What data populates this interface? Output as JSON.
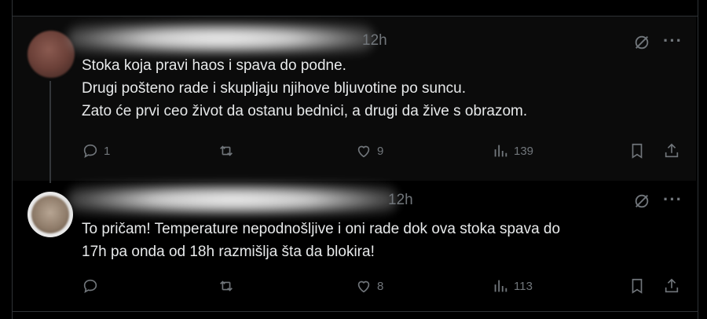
{
  "tweets": [
    {
      "time": "12h",
      "lines": [
        "Stoka koja pravi haos i spava do podne.",
        "Drugi pošteno rade i skupljaju njihove bljuvotine po suncu.",
        "Zato će prvi ceo život da ostanu bednici, a drugi da žive s obrazom."
      ],
      "replies": "1",
      "retweets": "",
      "likes": "9",
      "views": "139"
    },
    {
      "time": "12h",
      "lines": [
        "To pričam! Temperature nepodnošljive i oni rade dok ova stoka spava do",
        "17h pa onda od 18h razmišlja šta da blokira!"
      ],
      "replies": "",
      "retweets": "",
      "likes": "8",
      "views": "113"
    }
  ],
  "more_label": "···",
  "colors": {
    "background": "#000000",
    "text": "#e7e9ea",
    "muted": "#71767b",
    "border": "#2f3336"
  },
  "icons": [
    "reply-icon",
    "retweet-icon",
    "like-icon",
    "views-icon",
    "bookmark-icon",
    "share-icon",
    "grok-icon",
    "more-icon"
  ]
}
